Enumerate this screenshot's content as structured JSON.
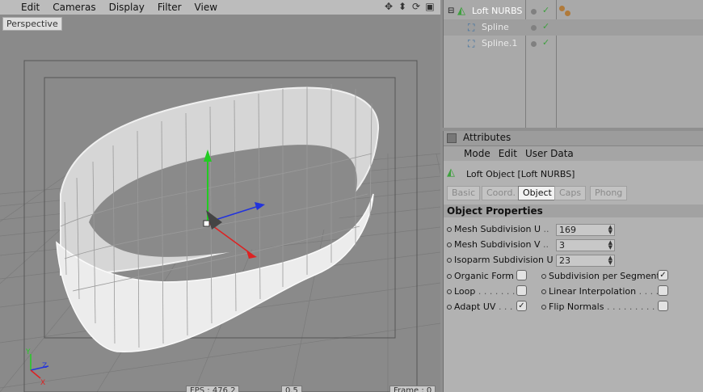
{
  "viewport": {
    "menu": [
      "Edit",
      "Cameras",
      "Display",
      "Filter",
      "View"
    ],
    "label": "Perspective",
    "hud": {
      "fps": "FPS : 476.2",
      "zoom": "0.5",
      "frame": "Frame : 0"
    },
    "axis_labels": {
      "y": "Y",
      "x": "X",
      "z": "Z"
    }
  },
  "object_manager": {
    "objects": [
      {
        "name": "Loft NURBS",
        "level": 0,
        "icon": "loft-icon"
      },
      {
        "name": "Spline",
        "level": 1,
        "icon": "spline-icon"
      },
      {
        "name": "Spline.1",
        "level": 1,
        "icon": "spline-icon"
      }
    ]
  },
  "attributes": {
    "title": "Attributes",
    "menu": [
      "Mode",
      "Edit",
      "User Data"
    ],
    "object_title": "Loft Object [Loft NURBS]",
    "tabs": [
      "Basic",
      "Coord.",
      "Object",
      "Caps",
      "Phong"
    ],
    "active_tab": "Object",
    "section": "Object Properties",
    "fields": [
      {
        "label": "Mesh Subdivision U",
        "dots": "..",
        "value": "169"
      },
      {
        "label": "Mesh Subdivision V",
        "dots": "..",
        "value": "3"
      },
      {
        "label": "Isoparm Subdivision U",
        "dots": "",
        "value": "23"
      }
    ],
    "checks_left": [
      {
        "label": "Organic Form",
        "dots": "",
        "checked": false,
        "mark": ""
      },
      {
        "label": "Loop",
        "dots": ". . . . . . . .",
        "checked": false,
        "mark": ""
      },
      {
        "label": "Adapt UV",
        "dots": ". . .",
        "checked": true,
        "mark": "✓"
      }
    ],
    "checks_right": [
      {
        "label": "Subdivision per Segment",
        "dots": "",
        "checked": true,
        "mark": "✓"
      },
      {
        "label": "Linear Interpolation",
        "dots": ". . . .",
        "checked": false,
        "mark": ""
      },
      {
        "label": "Flip Normals",
        "dots": ". . . . . . . . . . .",
        "checked": false,
        "mark": ""
      }
    ]
  },
  "colors": {
    "accent_green": "#3fa03f",
    "axis_y": "#22cc22",
    "axis_x": "#dd2222",
    "axis_z": "#2233dd"
  }
}
